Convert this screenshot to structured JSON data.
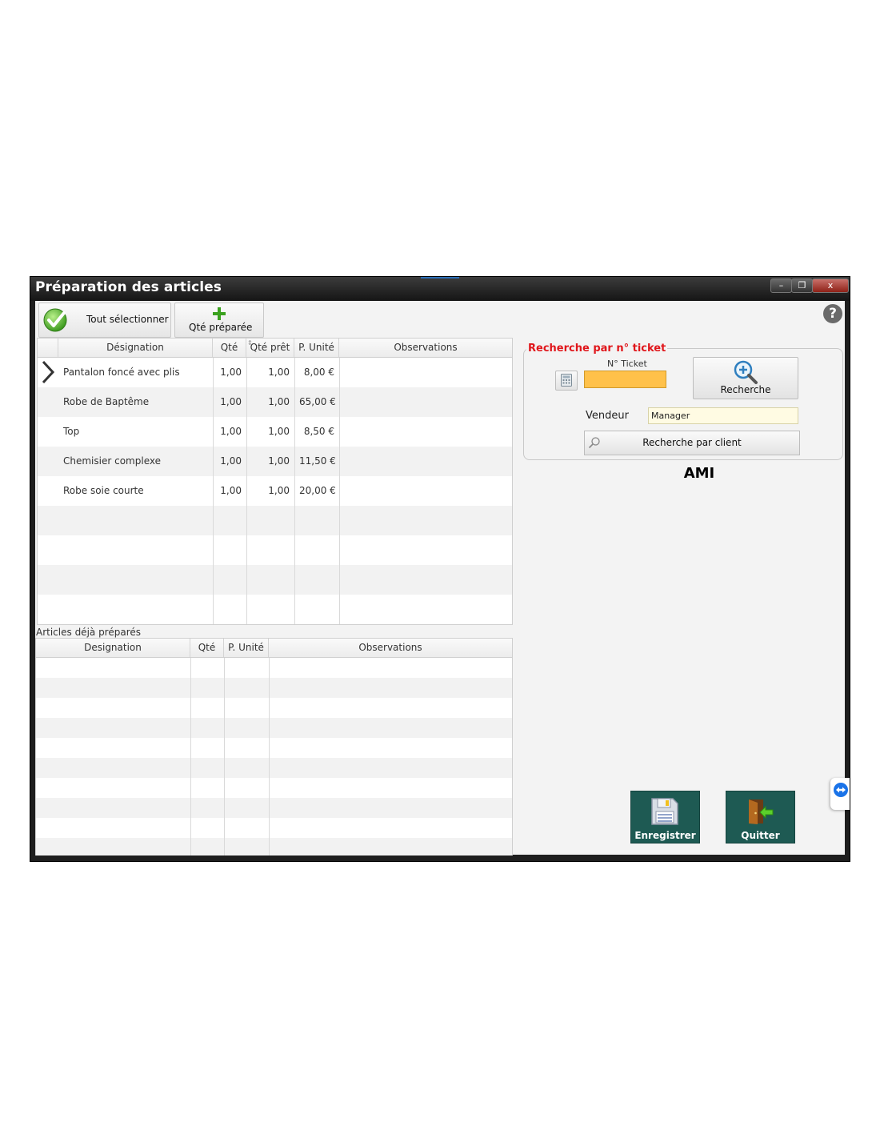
{
  "window": {
    "title": "Préparation des articles",
    "controls": {
      "minimize": "–",
      "restore": "❐",
      "close": "x"
    }
  },
  "toolbar": {
    "select_all_label": "Tout sélectionner",
    "qty_prepared_label": "Qté préparée",
    "help_label": "?"
  },
  "articles_grid": {
    "columns": [
      "Désignation",
      "Qté",
      "Qté prêt",
      "P. Unité",
      "Observations"
    ],
    "sort_glyph": "⇕",
    "current_row_marker": "❯",
    "rows": [
      {
        "designation": "Pantalon foncé avec plis",
        "qte": "1,00",
        "qte_pret": "1,00",
        "prix": "8,00 €",
        "obs": ""
      },
      {
        "designation": "Robe de Baptême",
        "qte": "1,00",
        "qte_pret": "1,00",
        "prix": "65,00 €",
        "obs": ""
      },
      {
        "designation": "Top",
        "qte": "1,00",
        "qte_pret": "1,00",
        "prix": "8,50 €",
        "obs": ""
      },
      {
        "designation": "Chemisier complexe",
        "qte": "1,00",
        "qte_pret": "1,00",
        "prix": "11,50 €",
        "obs": ""
      },
      {
        "designation": "Robe soie courte",
        "qte": "1,00",
        "qte_pret": "1,00",
        "prix": "20,00 €",
        "obs": ""
      }
    ]
  },
  "prepared_section": {
    "title": "Articles déjà préparés",
    "columns": [
      "Designation",
      "Qté",
      "P. Unité",
      "Observations"
    ]
  },
  "search_panel": {
    "legend": "Recherche par n° ticket",
    "ticket_label": "N° Ticket",
    "ticket_value": "",
    "search_button": "Recherche",
    "vendeur_label": "Vendeur",
    "vendeur_value": "Manager",
    "client_search_button": "Recherche par client",
    "site_name": "AMI"
  },
  "actions": {
    "save_label": "Enregistrer",
    "quit_label": "Quitter"
  },
  "colors": {
    "accent_red": "#e0161b",
    "ticket_field": "#ffc14a",
    "vendeur_field": "#fffbe3",
    "action_button": "#1e5a53"
  }
}
